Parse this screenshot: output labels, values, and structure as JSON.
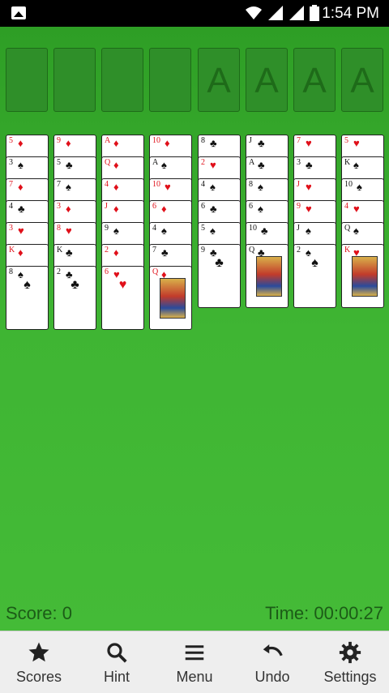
{
  "status_bar": {
    "time": "1:54 PM"
  },
  "foundations": [
    "A",
    "A",
    "A",
    "A"
  ],
  "game": {
    "score": "Score: 0",
    "time": "Time: 00:00:27"
  },
  "tableau": [
    [
      {
        "r": "5",
        "s": "♦"
      },
      {
        "r": "3",
        "s": "♠"
      },
      {
        "r": "7",
        "s": "♦"
      },
      {
        "r": "4",
        "s": "♣"
      },
      {
        "r": "3",
        "s": "♥"
      },
      {
        "r": "K",
        "s": "♦"
      },
      {
        "r": "8",
        "s": "♠"
      }
    ],
    [
      {
        "r": "9",
        "s": "♦"
      },
      {
        "r": "5",
        "s": "♣"
      },
      {
        "r": "7",
        "s": "♠"
      },
      {
        "r": "3",
        "s": "♦"
      },
      {
        "r": "8",
        "s": "♥"
      },
      {
        "r": "K",
        "s": "♣"
      },
      {
        "r": "2",
        "s": "♣"
      }
    ],
    [
      {
        "r": "A",
        "s": "♦"
      },
      {
        "r": "Q",
        "s": "♦"
      },
      {
        "r": "4",
        "s": "♦"
      },
      {
        "r": "J",
        "s": "♦"
      },
      {
        "r": "9",
        "s": "♠"
      },
      {
        "r": "2",
        "s": "♦"
      },
      {
        "r": "6",
        "s": "♥"
      }
    ],
    [
      {
        "r": "10",
        "s": "♦"
      },
      {
        "r": "A",
        "s": "♠"
      },
      {
        "r": "10",
        "s": "♥"
      },
      {
        "r": "6",
        "s": "♦"
      },
      {
        "r": "4",
        "s": "♠"
      },
      {
        "r": "7",
        "s": "♣"
      },
      {
        "r": "Q",
        "s": "♦"
      }
    ],
    [
      {
        "r": "8",
        "s": "♣"
      },
      {
        "r": "2",
        "s": "♥"
      },
      {
        "r": "4",
        "s": "♠"
      },
      {
        "r": "6",
        "s": "♣"
      },
      {
        "r": "5",
        "s": "♠"
      },
      {
        "r": "9",
        "s": "♣"
      }
    ],
    [
      {
        "r": "J",
        "s": "♣"
      },
      {
        "r": "A",
        "s": "♣"
      },
      {
        "r": "8",
        "s": "♠"
      },
      {
        "r": "6",
        "s": "♠"
      },
      {
        "r": "10",
        "s": "♣"
      },
      {
        "r": "Q",
        "s": "♣"
      }
    ],
    [
      {
        "r": "7",
        "s": "♥"
      },
      {
        "r": "3",
        "s": "♣"
      },
      {
        "r": "J",
        "s": "♥"
      },
      {
        "r": "9",
        "s": "♥"
      },
      {
        "r": "J",
        "s": "♠"
      },
      {
        "r": "2",
        "s": "♠"
      }
    ],
    [
      {
        "r": "5",
        "s": "♥"
      },
      {
        "r": "K",
        "s": "♠"
      },
      {
        "r": "10",
        "s": "♠"
      },
      {
        "r": "4",
        "s": "♥"
      },
      {
        "r": "Q",
        "s": "♠"
      },
      {
        "r": "K",
        "s": "♥"
      }
    ]
  ],
  "bottom_nav": [
    {
      "label": "Scores",
      "icon": "star-icon"
    },
    {
      "label": "Hint",
      "icon": "search-icon"
    },
    {
      "label": "Menu",
      "icon": "menu-icon"
    },
    {
      "label": "Undo",
      "icon": "undo-icon"
    },
    {
      "label": "Settings",
      "icon": "gear-icon"
    }
  ]
}
